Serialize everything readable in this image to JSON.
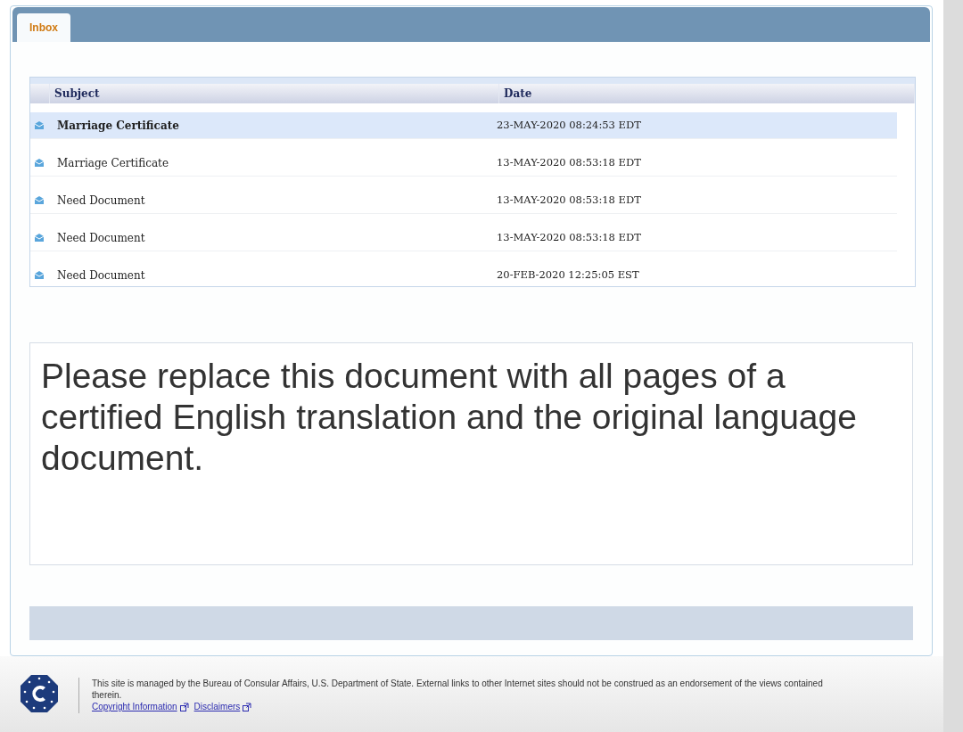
{
  "tabs": [
    {
      "label": "Inbox",
      "selected": true
    }
  ],
  "table": {
    "columns": [
      "Subject",
      "Date"
    ],
    "rows": [
      {
        "subject": "Marriage Certificate",
        "date": "23-MAY-2020 08:24:53 EDT",
        "selected": true,
        "unread": true
      },
      {
        "subject": "Marriage Certificate",
        "date": "13-MAY-2020 08:53:18 EDT",
        "selected": false,
        "unread": false
      },
      {
        "subject": "Need Document",
        "date": "13-MAY-2020 08:53:18 EDT",
        "selected": false,
        "unread": false
      },
      {
        "subject": "Need Document",
        "date": "13-MAY-2020 08:53:18 EDT",
        "selected": false,
        "unread": false
      },
      {
        "subject": "Need Document",
        "date": "20-FEB-2020 12:25:05 EST",
        "selected": false,
        "unread": false
      }
    ]
  },
  "message": "Please replace this document with all pages of a certified English translation and the original language document.",
  "footer": {
    "notice": "This site is managed by the Bureau of Consular Affairs, U.S. Department of State. External links to other Internet sites should not be construed as an endorsement of the views contained therein.",
    "links": [
      "Copyright Information",
      "Disclaimers"
    ]
  }
}
